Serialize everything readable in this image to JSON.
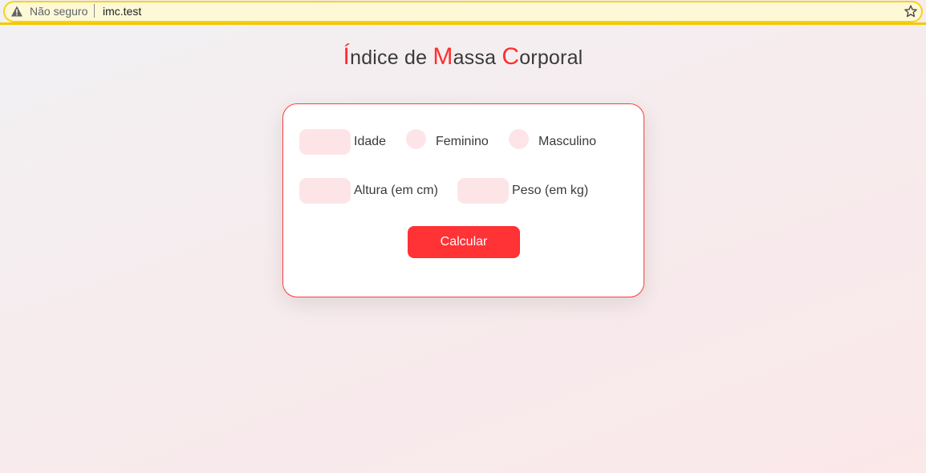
{
  "browser": {
    "security_label": "Não seguro",
    "url": "imc.test",
    "warning_icon": "warning-triangle-icon",
    "bookmark_icon": "star-icon",
    "accent_color": "#f7d11e"
  },
  "page": {
    "title_parts": {
      "i_cap": "Í",
      "i_rest": "ndice de ",
      "m_cap": "M",
      "m_rest": "assa ",
      "c_cap": "C",
      "c_rest": "orporal"
    },
    "accent_color": "#ff2e2e"
  },
  "form": {
    "age_label": "Idade",
    "age_value": "",
    "female_label": "Feminino",
    "male_label": "Masculino",
    "height_label": "Altura (em cm)",
    "height_value": "",
    "weight_label": "Peso (em kg)",
    "weight_value": "",
    "submit_label": "Calcular"
  }
}
